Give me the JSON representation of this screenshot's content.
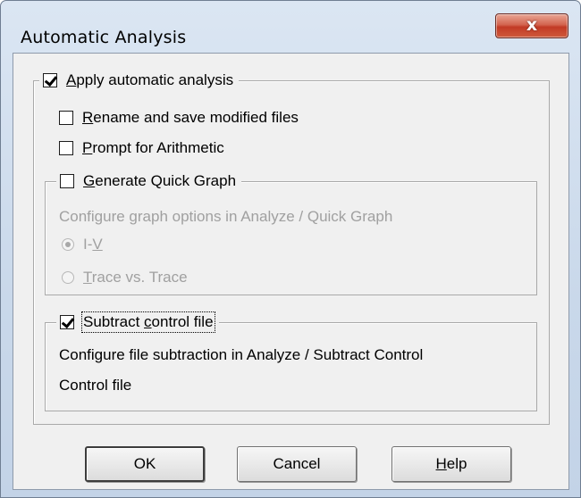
{
  "window": {
    "title": "Automatic Analysis",
    "close_glyph": "x"
  },
  "apply_group": {
    "label_mnemonic": "A",
    "label_rest": "pply automatic analysis",
    "checked": true
  },
  "options": {
    "rename": {
      "mnemonic": "R",
      "rest": "ename and save modified files",
      "checked": false
    },
    "prompt": {
      "mnemonic": "P",
      "rest": "rompt for Arithmetic",
      "checked": false
    }
  },
  "quick_graph_group": {
    "label_mnemonic": "G",
    "label_rest": "enerate Quick Graph",
    "checked": false,
    "info": "Configure graph options in Analyze / Quick Graph",
    "radio_iv": {
      "prefix": "I-",
      "mnemonic": "V",
      "selected": true
    },
    "radio_trace": {
      "mnemonic": "T",
      "rest": "race vs. Trace",
      "selected": false
    }
  },
  "subtract_group": {
    "label_prefix": "Subtract ",
    "label_mnemonic": "c",
    "label_rest": "ontrol file",
    "checked": true,
    "info": "Configure file subtraction in Analyze / Subtract Control",
    "control_file_label": "Control file"
  },
  "buttons": {
    "ok": "OK",
    "cancel": "Cancel",
    "help_mnemonic": "H",
    "help_rest": "elp"
  },
  "icons": {
    "checkbox": "checkbox-icon",
    "radio": "radio-icon",
    "close": "close-icon"
  }
}
